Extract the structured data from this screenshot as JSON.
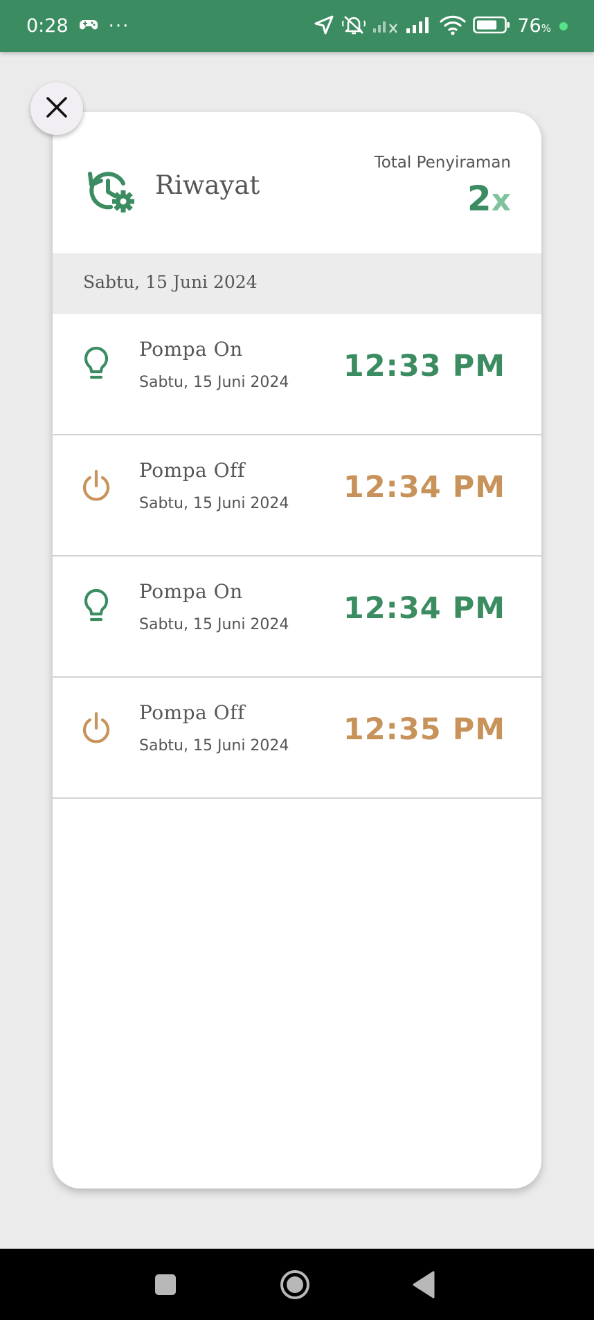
{
  "status_bar": {
    "time": "0:28",
    "more": "···",
    "battery_percent": "76",
    "battery_unit": "%",
    "battery_level": 0.76
  },
  "dialog": {
    "close_icon": "close-icon",
    "header": {
      "icon": "history-settings-icon",
      "title": "Riwayat",
      "total_label": "Total Penyiraman",
      "total_count": "2",
      "total_suffix": "x"
    },
    "date_section": "Sabtu, 15 Juni 2024",
    "items": [
      {
        "title": "Pompa On",
        "date": "Sabtu, 15 Juni 2024",
        "time": "12:33 PM",
        "state": "on",
        "icon": "lightbulb-icon"
      },
      {
        "title": "Pompa Off",
        "date": "Sabtu, 15 Juni 2024",
        "time": "12:34 PM",
        "state": "off",
        "icon": "power-icon"
      },
      {
        "title": "Pompa On",
        "date": "Sabtu, 15 Juni 2024",
        "time": "12:34 PM",
        "state": "on",
        "icon": "lightbulb-icon"
      },
      {
        "title": "Pompa Off",
        "date": "Sabtu, 15 Juni 2024",
        "time": "12:35 PM",
        "state": "off",
        "icon": "power-icon"
      }
    ]
  },
  "colors": {
    "primary_green": "#3c8c62",
    "light_green": "#7fc39d",
    "off_orange": "#c8935a",
    "text_gray": "#555555"
  },
  "nav_bar": {
    "recents_icon": "square-icon",
    "home_icon": "circle-icon",
    "back_icon": "triangle-back-icon"
  }
}
